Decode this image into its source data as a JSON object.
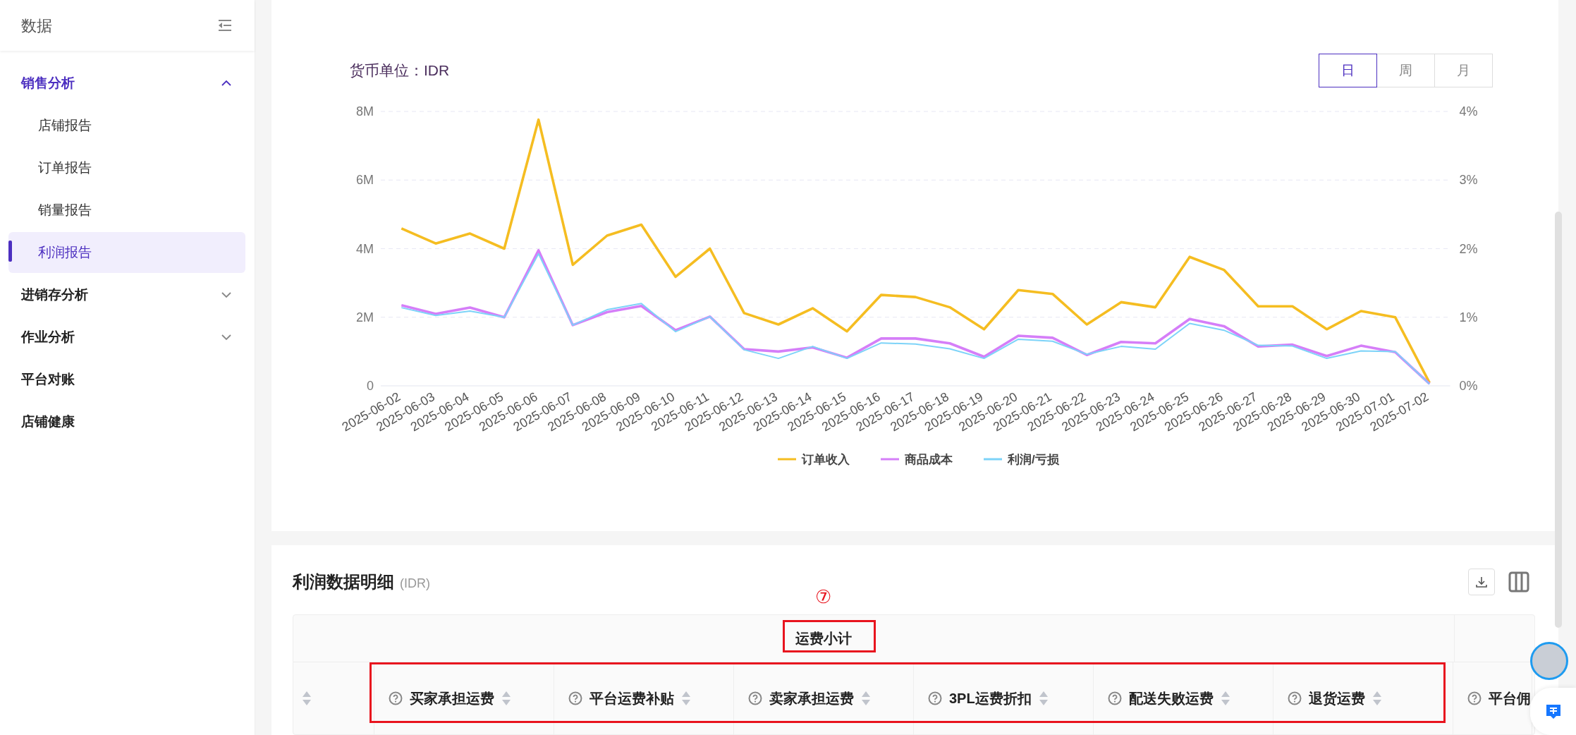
{
  "sidebar": {
    "title": "数据",
    "groups": [
      {
        "label": "销售分析",
        "expanded": true,
        "children": [
          {
            "label": "店铺报告",
            "selected": false
          },
          {
            "label": "订单报告",
            "selected": false
          },
          {
            "label": "销量报告",
            "selected": false
          },
          {
            "label": "利润报告",
            "selected": true
          }
        ]
      },
      {
        "label": "进销存分析",
        "expanded": false
      },
      {
        "label": "作业分析",
        "expanded": false
      },
      {
        "label": "平台对账"
      },
      {
        "label": "店铺健康"
      }
    ]
  },
  "chart_card": {
    "currency_label": "货币单位：IDR",
    "periods": [
      {
        "label": "日",
        "selected": true
      },
      {
        "label": "周",
        "selected": false
      },
      {
        "label": "月",
        "selected": false
      }
    ],
    "chart_data": {
      "type": "line",
      "categories": [
        "2025-06-02",
        "2025-06-03",
        "2025-06-04",
        "2025-06-05",
        "2025-06-06",
        "2025-06-07",
        "2025-06-08",
        "2025-06-09",
        "2025-06-10",
        "2025-06-11",
        "2025-06-12",
        "2025-06-13",
        "2025-06-14",
        "2025-06-15",
        "2025-06-16",
        "2025-06-17",
        "2025-06-18",
        "2025-06-19",
        "2025-06-20",
        "2025-06-21",
        "2025-06-22",
        "2025-06-23",
        "2025-06-24",
        "2025-06-25",
        "2025-06-26",
        "2025-06-27",
        "2025-06-28",
        "2025-06-29",
        "2025-06-30",
        "2025-07-01",
        "2025-07-02"
      ],
      "series": [
        {
          "name": "订单收入",
          "color": "#f5bd21",
          "values": [
            4590000,
            4150000,
            4440000,
            4000000,
            7760000,
            3530000,
            4380000,
            4700000,
            3180000,
            4000000,
            2120000,
            1790000,
            2260000,
            1590000,
            2650000,
            2590000,
            2290000,
            1650000,
            2790000,
            2680000,
            1790000,
            2440000,
            2290000,
            3760000,
            3380000,
            2320000,
            2320000,
            1650000,
            2180000,
            2000000,
            90000
          ]
        },
        {
          "name": "商品成本",
          "color": "#d57ef8",
          "values": [
            2350000,
            2100000,
            2280000,
            2000000,
            3950000,
            1770000,
            2150000,
            2330000,
            1620000,
            2020000,
            1070000,
            1000000,
            1120000,
            820000,
            1380000,
            1380000,
            1240000,
            850000,
            1460000,
            1400000,
            900000,
            1280000,
            1240000,
            1950000,
            1740000,
            1150000,
            1200000,
            870000,
            1170000,
            980000,
            60000
          ]
        },
        {
          "name": "利润/亏损",
          "color": "#7dd3f8",
          "values": [
            2280000,
            2050000,
            2180000,
            2000000,
            3850000,
            1770000,
            2220000,
            2400000,
            1580000,
            2020000,
            1050000,
            800000,
            1150000,
            800000,
            1250000,
            1220000,
            1080000,
            800000,
            1360000,
            1300000,
            920000,
            1150000,
            1070000,
            1820000,
            1620000,
            1180000,
            1160000,
            800000,
            1020000,
            1000000,
            50000
          ]
        }
      ],
      "ylim": [
        0,
        8000000
      ],
      "y2lim": [
        0,
        0.04
      ],
      "grid": true,
      "legend": true,
      "yticks": [
        {
          "value": 0,
          "label": "0"
        },
        {
          "value": 2000000,
          "label": "2M"
        },
        {
          "value": 4000000,
          "label": "4M"
        },
        {
          "value": 6000000,
          "label": "6M"
        },
        {
          "value": 8000000,
          "label": "8M"
        }
      ],
      "y2ticks": [
        {
          "value": 0,
          "label": "0%"
        },
        {
          "value": 0.01,
          "label": "1%"
        },
        {
          "value": 0.02,
          "label": "2%"
        },
        {
          "value": 0.03,
          "label": "3%"
        },
        {
          "value": 0.04,
          "label": "4%"
        }
      ]
    }
  },
  "table_card": {
    "title": "利润数据明细",
    "unit": "(IDR)",
    "table": {
      "group_header": "运费小计",
      "columns": [
        "买家承担运费",
        "平台运费补贴",
        "卖家承担运费",
        "3PL运费折扣",
        "配送失败运费",
        "退货运费",
        "平台佣"
      ]
    },
    "annotation": {
      "number": "⑦"
    }
  }
}
